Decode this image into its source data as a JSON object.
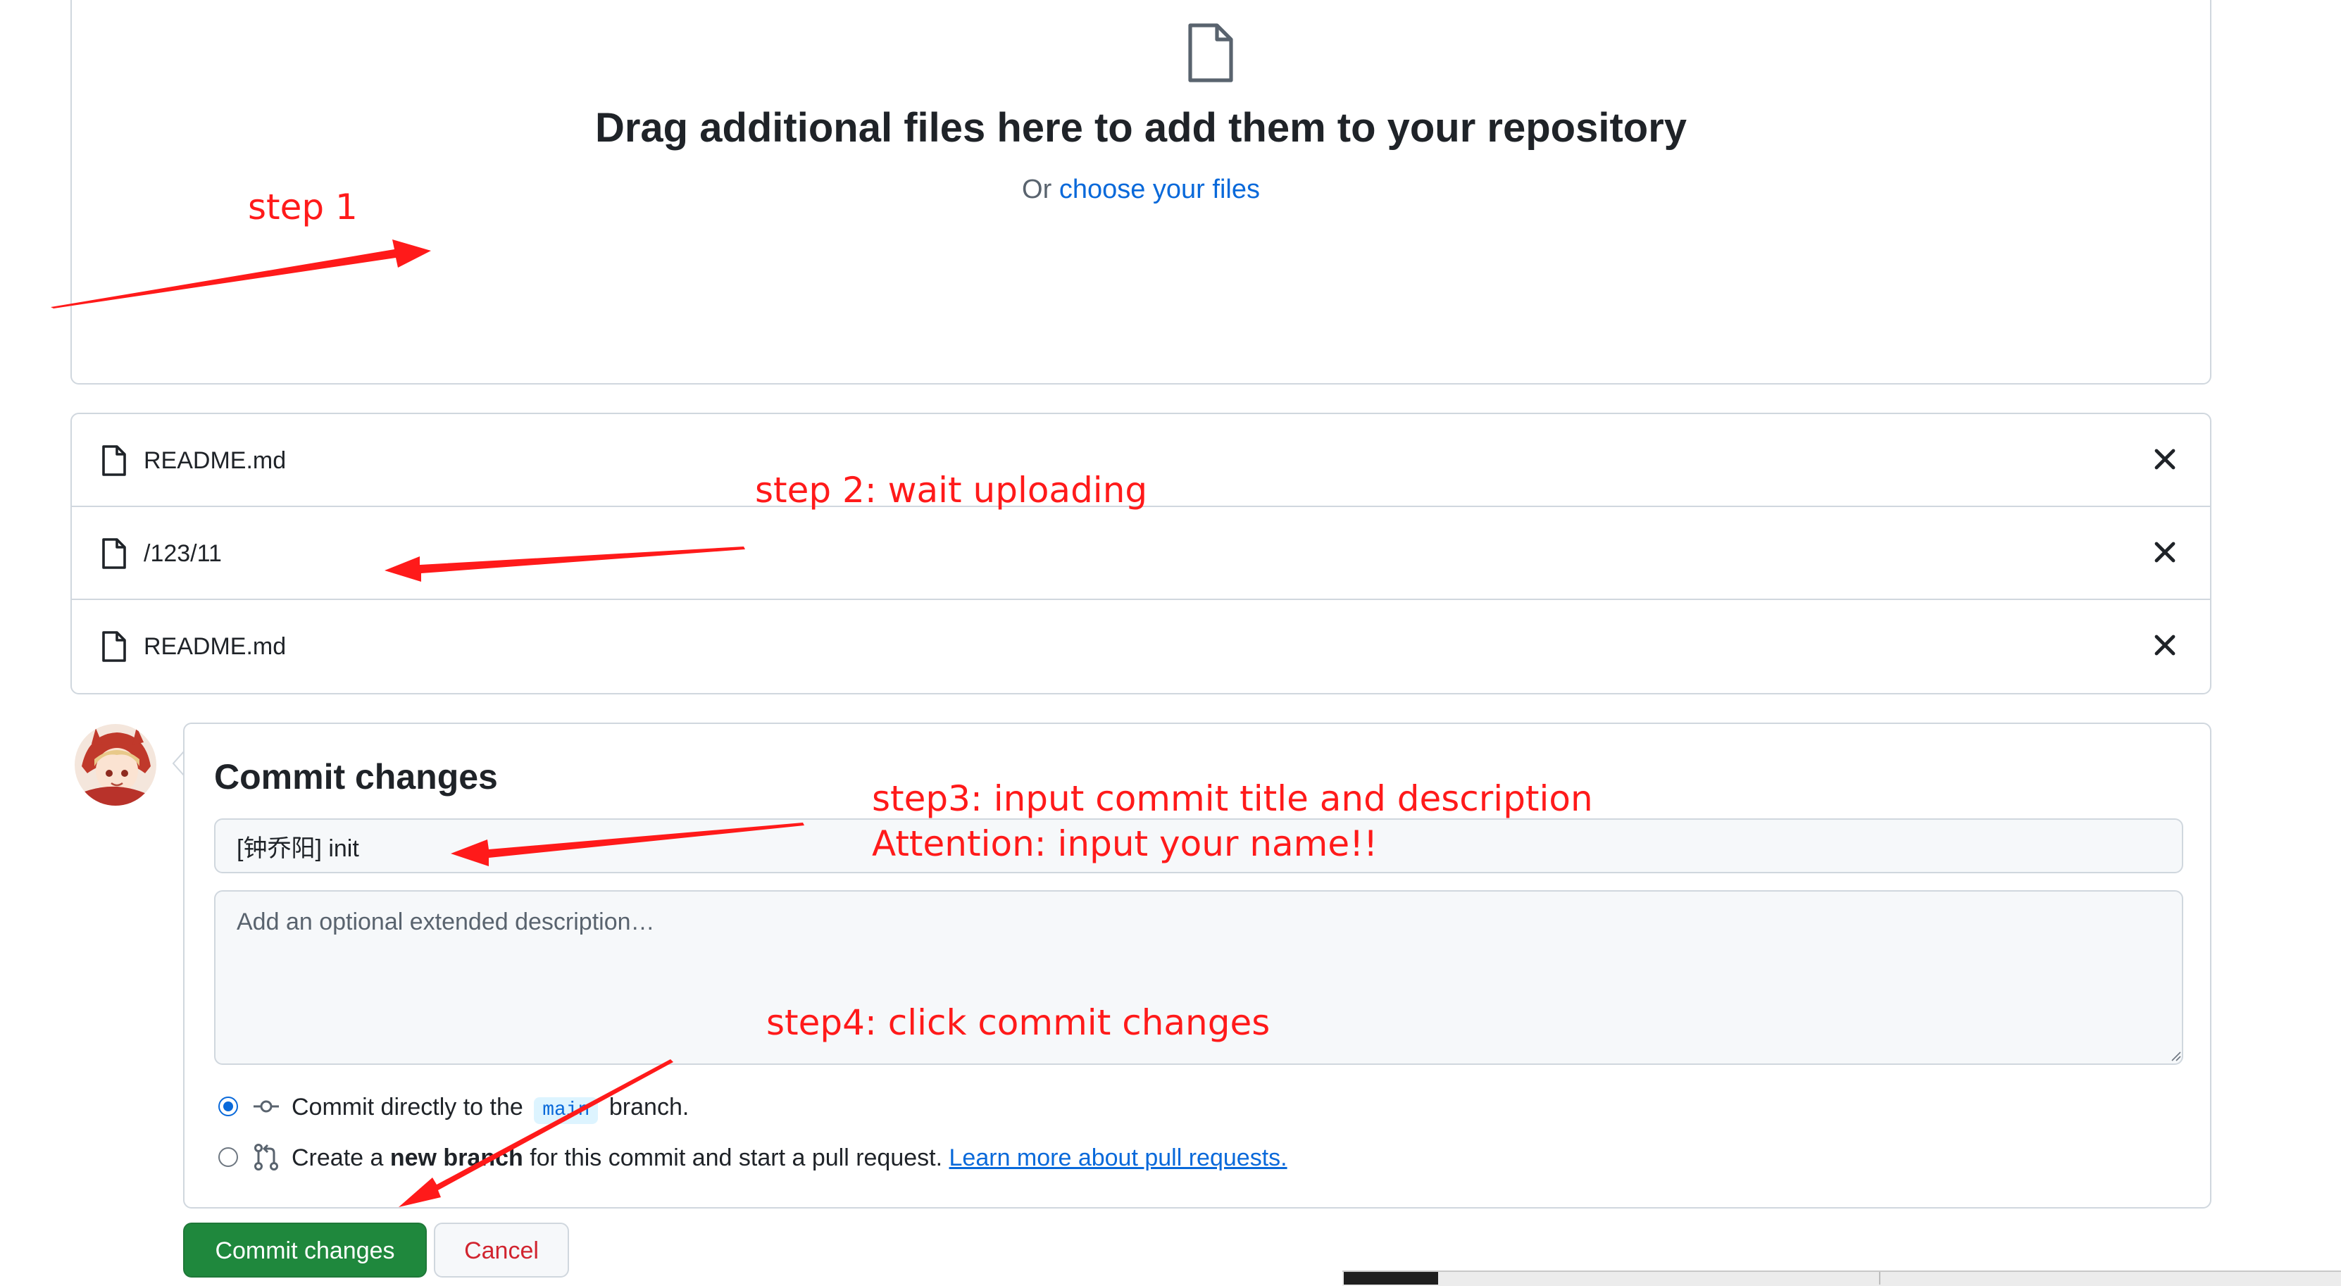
{
  "dropzone": {
    "title": "Drag additional files here to add them to your repository",
    "or_text": "Or",
    "choose_link": "choose your files"
  },
  "files": [
    {
      "name": "README.md"
    },
    {
      "name": "/123/11"
    },
    {
      "name": "README.md"
    }
  ],
  "commit": {
    "heading": "Commit changes",
    "title_value": "[钟乔阳] init",
    "description_placeholder": "Add an optional extended description…",
    "option_direct": {
      "text_before": "Commit directly to the",
      "branch": "main",
      "text_after": "branch.",
      "selected": true
    },
    "option_new_branch": {
      "text_before": "Create a",
      "bold": "new branch",
      "text_after": "for this commit and start a pull request.",
      "link": "Learn more about pull requests.",
      "selected": false
    },
    "commit_button": "Commit changes",
    "cancel_button": "Cancel"
  },
  "annotations": {
    "step1": "step 1",
    "step2": "step 2: wait uploading",
    "step3_line1": "step3: input commit title and description",
    "step3_line2": "Attention: input your name!!",
    "step4": "step4: click commit changes",
    "color": "#ff1a1a"
  },
  "colors": {
    "primary_button": "#1f883d",
    "link": "#0969da",
    "danger_text": "#d1242f",
    "border": "#d0d7de"
  },
  "icons": {
    "file": "file-icon",
    "close": "x-icon",
    "commit": "git-commit-icon",
    "pull_request": "git-pull-request-icon"
  }
}
